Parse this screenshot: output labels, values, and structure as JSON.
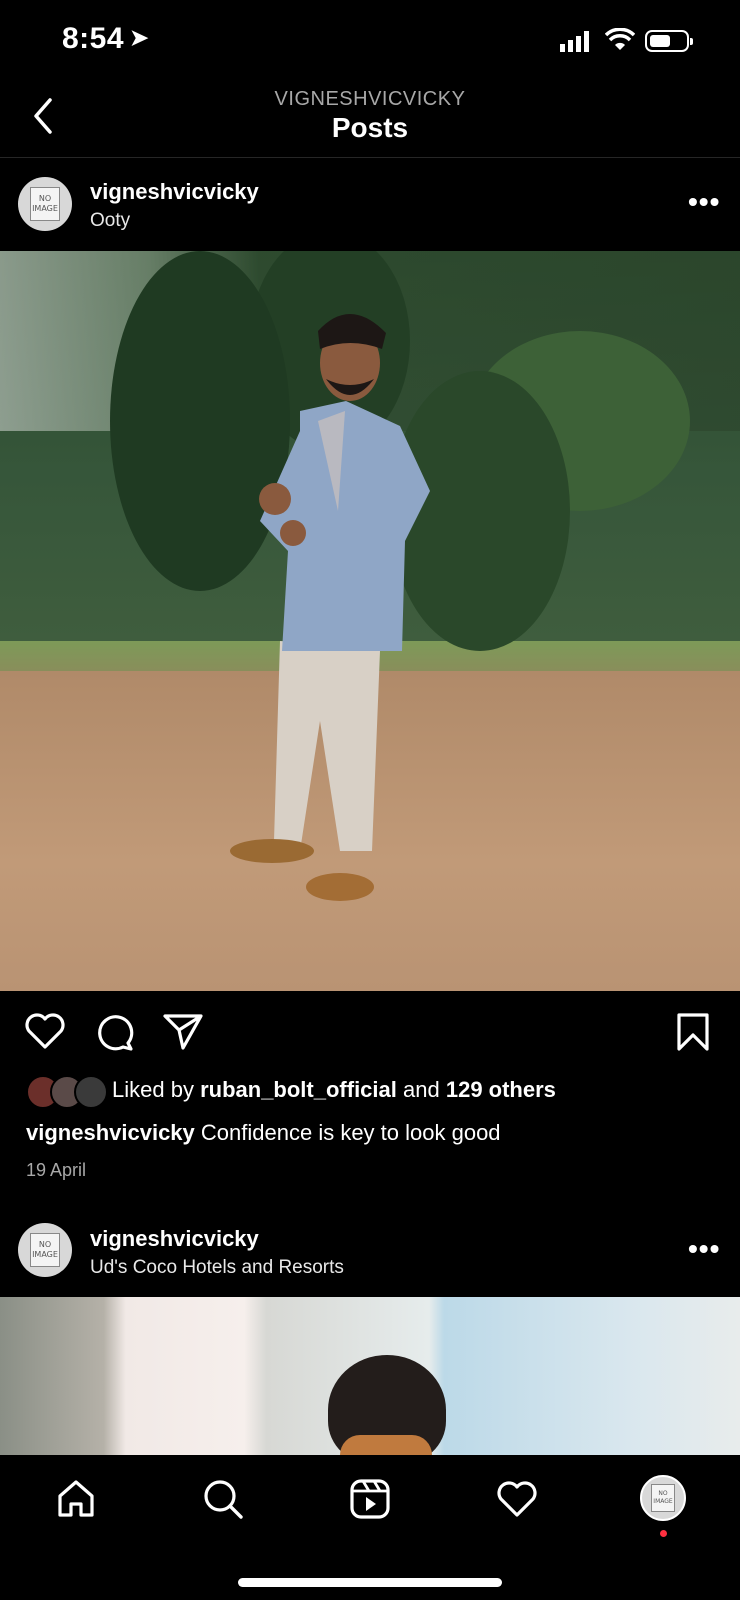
{
  "status_bar": {
    "time": "8:54"
  },
  "header": {
    "account": "VIGNESHVICVICKY",
    "title": "Posts"
  },
  "posts": [
    {
      "username": "vigneshvicvicky",
      "location": "Ooty",
      "avatar_text": "NO IMAGE",
      "liked_by_prefix": "Liked by",
      "liked_by_user": "ruban_bolt_official",
      "liked_by_and": "and",
      "liked_by_others": "129 others",
      "caption_user": "vigneshvicvicky",
      "caption_text": "Confidence is key to look good",
      "date": "19 April"
    },
    {
      "username": "vigneshvicvicky",
      "location": "Ud's Coco Hotels and Resorts",
      "avatar_text": "NO IMAGE"
    }
  ],
  "tab_bar": {
    "items": [
      "home-icon",
      "search-icon",
      "reels-icon",
      "activity-heart-icon",
      "profile-avatar"
    ],
    "profile_avatar_text": "NO IMAGE"
  },
  "colors": {
    "background": "#000000",
    "muted_text": "#a8a8a8",
    "notification_dot": "#ff3040"
  }
}
